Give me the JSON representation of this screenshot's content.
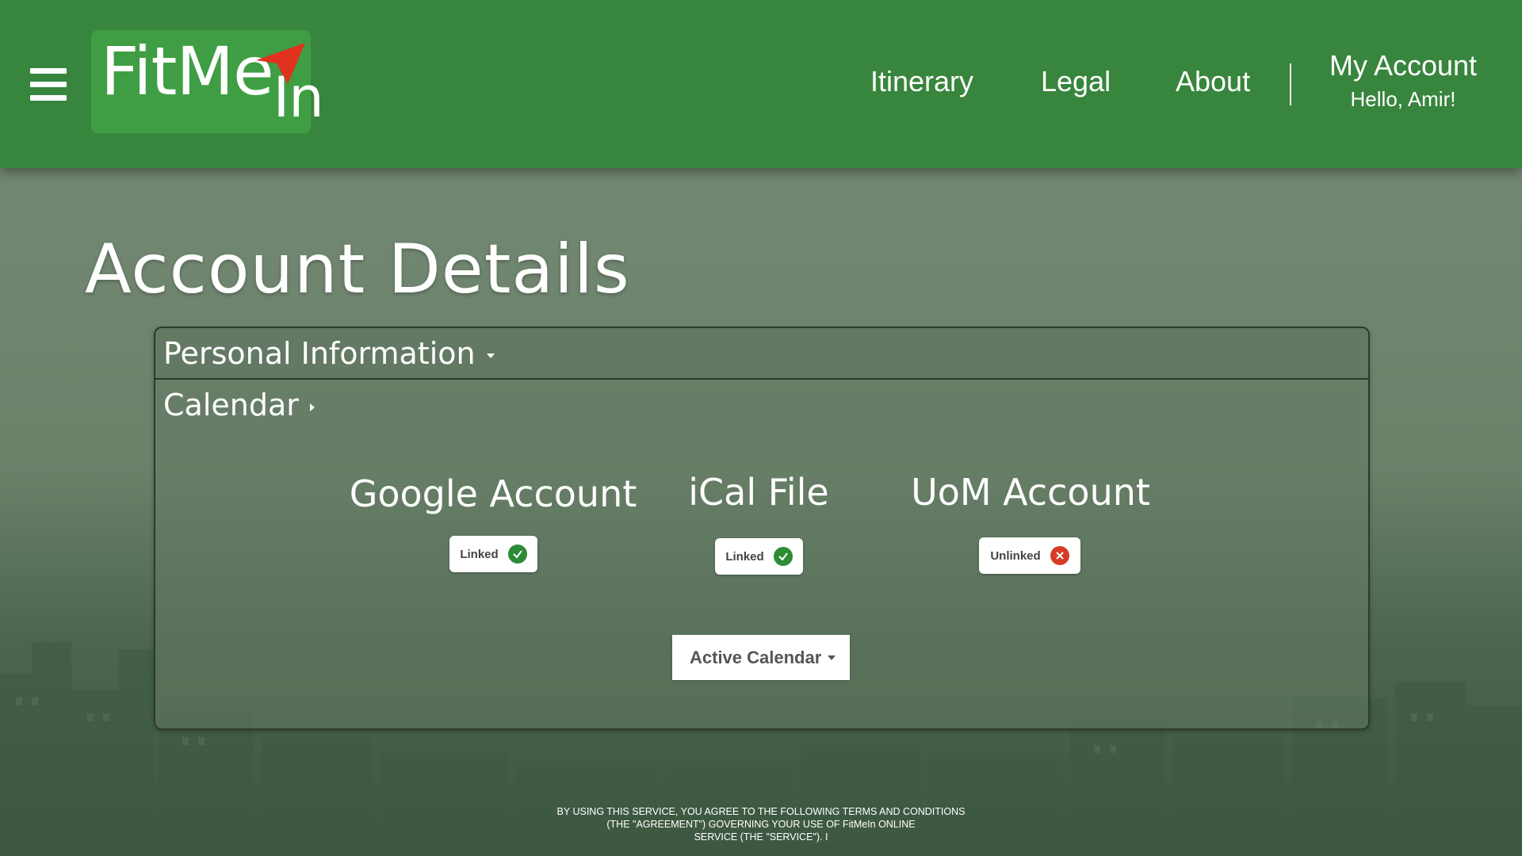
{
  "header": {
    "logo_text_main": "FitMe",
    "logo_text_sub": "In",
    "nav": [
      {
        "label": "Itinerary"
      },
      {
        "label": "Legal"
      },
      {
        "label": "About"
      }
    ],
    "account": {
      "title": "My Account",
      "greeting": "Hello, Amir!"
    }
  },
  "page": {
    "title": "Account Details"
  },
  "sections": {
    "personal_info": "Personal Information",
    "calendar": "Calendar"
  },
  "calendar_accounts": [
    {
      "title": "Google Account",
      "status": "Linked",
      "icon": "check-icon"
    },
    {
      "title": "iCal File",
      "status": "Linked",
      "icon": "check-icon"
    },
    {
      "title": "UoM Account",
      "status": "Unlinked",
      "icon": "close-icon"
    }
  ],
  "active_calendar": {
    "label": "Active Calendar"
  },
  "footer": {
    "line1": "BY USING THIS SERVICE, YOU AGREE TO THE FOLLOWING TERMS AND CONDITIONS",
    "line2": "(THE \"AGREEMENT\") GOVERNING YOUR USE OF FitMeIn ONLINE",
    "line3": "SERVICE (THE \"SERVICE\"). I"
  },
  "colors": {
    "header_green": "#38853d",
    "logo_green": "#3f9e44",
    "linked_green": "#2e8b35",
    "unlinked_red": "#d63b26",
    "arrow_red": "#e0321f"
  }
}
